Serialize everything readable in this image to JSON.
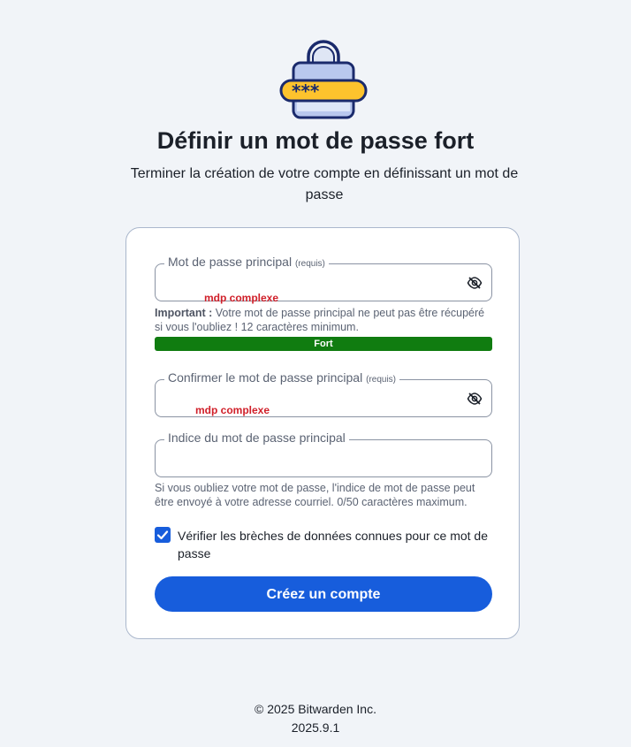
{
  "header": {
    "logo_icon": "lock-password-icon",
    "title": "Définir un mot de passe fort",
    "subtitle": "Terminer la création de votre compte en définissant un mot de passe"
  },
  "form": {
    "master_password": {
      "label": "Mot de passe principal",
      "required": "(requis)",
      "value_overlay": "mdp complexe",
      "toggle_icon": "eye-slash-icon"
    },
    "important_label": "Important :",
    "important_text": "Votre mot de passe principal ne peut pas être récupéré si vous l'oubliez ! 12 caractères minimum.",
    "strength": {
      "label": "Fort",
      "level": 1.0,
      "color": "#107c10"
    },
    "confirm_password": {
      "label": "Confirmer le mot de passe principal",
      "required": "(requis)",
      "value_overlay": "mdp complexe",
      "toggle_icon": "eye-slash-icon"
    },
    "hint_field": {
      "label": "Indice du mot de passe principal",
      "value": ""
    },
    "hint_help": "Si vous oubliez votre mot de passe, l'indice de mot de passe peut être envoyé à votre adresse courriel. 0/50 caractères maximum.",
    "breach_check": {
      "checked": true,
      "label": "Vérifier les brèches de données connues pour ce mot de passe"
    },
    "submit_label": "Créez un compte"
  },
  "footer": {
    "copyright": "© 2025 Bitwarden Inc.",
    "version": "2025.9.1"
  },
  "colors": {
    "accent": "#175ddc",
    "strong": "#107c10",
    "background": "#f1f4f8"
  }
}
